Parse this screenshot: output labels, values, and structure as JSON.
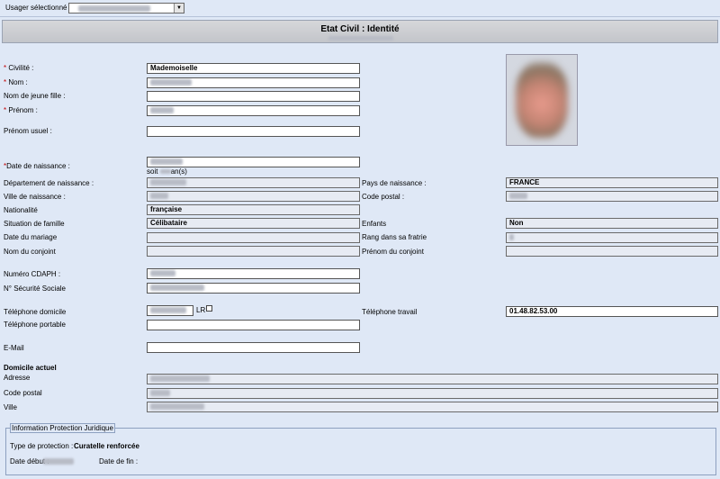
{
  "top": {
    "usager_label": "Usager sélectionné :",
    "usager_value": ""
  },
  "header": {
    "title": "Etat Civil : Identité"
  },
  "identity": {
    "civilite_label": "Civilité :",
    "civilite_value": "Mademoiselle",
    "nom_label": "Nom :",
    "nom_jeune_fille_label": "Nom de jeune fille :",
    "prenom_label": "Prénom :",
    "prenom_usuel_label": "Prénom usuel :",
    "date_naissance_label": "Date de naissance :",
    "soit_label": "soit",
    "ans_label": "an(s)",
    "departement_label": "Département de naissance :",
    "pays_label": "Pays de naissance :",
    "pays_value": "FRANCE",
    "ville_label": "Ville de naissance :",
    "code_postal_label": "Code postal :",
    "nationalite_label": "Nationalité",
    "nationalite_value": "française",
    "situation_label": "Situation de famille",
    "situation_value": "Célibataire",
    "enfants_label": "Enfants",
    "enfants_value": "Non",
    "date_mariage_label": "Date du mariage",
    "rang_label": "Rang dans sa fratrie",
    "nom_conjoint_label": "Nom du conjoint",
    "prenom_conjoint_label": "Prénom du conjoint",
    "cdaph_label": "Numéro CDAPH :",
    "secu_label": "N° Sécurité Sociale"
  },
  "contact": {
    "tel_domicile_label": "Téléphone domicile",
    "lr_label": "LR",
    "tel_travail_label": "Téléphone travail",
    "tel_travail_value": "01.48.82.53.00",
    "tel_portable_label": "Téléphone portable",
    "email_label": "E-Mail"
  },
  "domicile": {
    "section_label": "Domicile actuel",
    "adresse_label": "Adresse",
    "code_postal_label": "Code postal",
    "ville_label": "Ville"
  },
  "protection": {
    "legend": "Information Protection Juridique",
    "type_label": "Type de protection :",
    "type_value": "Curatelle renforcée",
    "date_debut_label": "Date début :",
    "date_fin_label": "Date de fin :"
  }
}
